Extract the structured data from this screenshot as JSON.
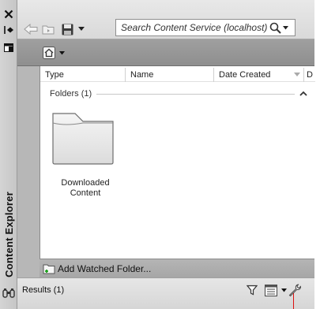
{
  "palette": {
    "title": "Content Explorer",
    "close_icon": "close-icon",
    "autohide_icon": "autohide-icon",
    "properties_icon": "properties-icon"
  },
  "toolbar": {
    "back_icon": "back-arrow-icon",
    "folder_view_icon": "folder-view-icon",
    "save_icon": "save-icon",
    "dropdown_icon": "chevron-down-icon",
    "search_placeholder": "Search Content Service (localhost)",
    "search_icon": "search-icon"
  },
  "navbar": {
    "home_icon": "home-icon"
  },
  "list": {
    "columns": [
      "Type",
      "Name",
      "Date Created",
      "D"
    ],
    "group_label": "Folders (1)",
    "items": [
      {
        "label_line1": "Downloaded",
        "label_line2": "Content",
        "icon": "folder-icon"
      }
    ]
  },
  "addbar": {
    "label": "Add Watched Folder...",
    "icon": "add-folder-icon"
  },
  "status": {
    "results": "Results (1)",
    "filter_icon": "filter-icon",
    "view_icon": "view-options-icon",
    "settings_icon": "wrench-icon"
  },
  "colors": {
    "frame": "#b7b7b7",
    "navbar": "#949494",
    "accent_red": "#d11111"
  }
}
